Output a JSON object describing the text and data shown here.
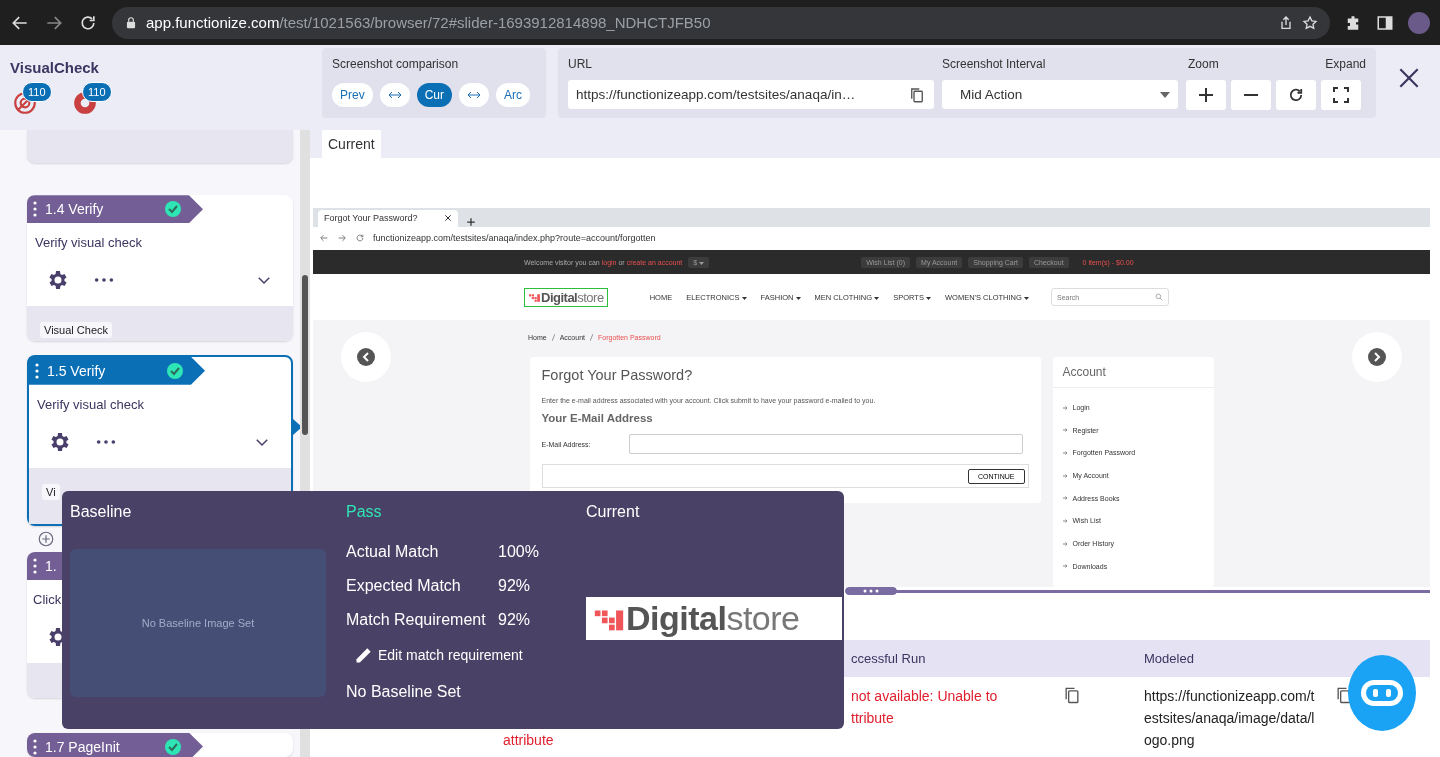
{
  "browser": {
    "url_host": "app.functionize.com",
    "url_path": "/test/1021563/browser/72#slider-1693912814898_NDHCTJFB50"
  },
  "app": {
    "title": "VisualCheck",
    "badges": [
      {
        "kind": "target",
        "count": "110"
      },
      {
        "kind": "donut",
        "count": "110"
      }
    ]
  },
  "comparison": {
    "label": "Screenshot comparison",
    "buttons": [
      {
        "kind": "text",
        "label": "Prev",
        "selected": false
      },
      {
        "kind": "swap",
        "selected": false
      },
      {
        "kind": "text",
        "label": "Cur",
        "selected": true
      },
      {
        "kind": "swap",
        "selected": false
      },
      {
        "kind": "text",
        "label": "Arc",
        "selected": false
      }
    ]
  },
  "url": {
    "label": "URL",
    "value": "https://functionizeapp.com/testsites/anaqa/in…"
  },
  "interval": {
    "label": "Screenshot Interval",
    "value": "Mid Action"
  },
  "zoom": {
    "label": "Zoom"
  },
  "expand": {
    "label": "Expand"
  },
  "steps": [
    {
      "title": "1.4 Verify",
      "description": "Verify visual check",
      "tag": "Visual Check",
      "passed": true,
      "selected": false
    },
    {
      "title": "1.5 Verify",
      "description": "Verify visual check",
      "tag": "Vi",
      "passed": true,
      "selected": true
    },
    {
      "title": "1.",
      "description": "Click",
      "selected": false
    },
    {
      "title": "1.7 PageInit",
      "passed": true,
      "selected": false
    }
  ],
  "main_tabs": [
    {
      "label": "Current",
      "selected": true
    }
  ],
  "inner": {
    "tab": "Forgot Your Password?",
    "address": "functionizeapp.com/testsites/anaqa/index.php?route=account/forgotten",
    "welcome": {
      "text": "Welcome visitor you can",
      "login": "login",
      "or": "or",
      "create": "create an account"
    },
    "currency": "$",
    "top_links": [
      "Wish List (0)",
      "My Account",
      "Shopping Cart",
      "Checkout"
    ],
    "cart": "0 item(s) - $0.00",
    "logo": "**Digital**store",
    "nav": [
      {
        "label": "HOME",
        "has_menu": false
      },
      {
        "label": "ELECTRONICS",
        "has_menu": true
      },
      {
        "label": "FASHION",
        "has_menu": true
      },
      {
        "label": "MEN CLOTHING",
        "has_menu": true
      },
      {
        "label": "SPORTS",
        "has_menu": true
      },
      {
        "label": "WOMEN'S CLOTHING",
        "has_menu": true
      }
    ],
    "search_placeholder": "Search",
    "breadcrumb": [
      {
        "label": "Home",
        "current": false
      },
      {
        "label": "Account",
        "current": false
      },
      {
        "label": "Forgotten Password",
        "current": true
      }
    ],
    "form": {
      "title": "Forgot Your Password?",
      "intro": "Enter the e-mail address associated with your account. Click submit to have your password e-mailed to you.",
      "section": "Your E-Mail Address",
      "field_label": "E-Mail Address:",
      "button": "CONTINUE"
    },
    "account": {
      "title": "Account",
      "links": [
        "Login",
        "Register",
        "Forgotten Password",
        "My Account",
        "Address Books",
        "Wish List",
        "Order History",
        "Downloads"
      ]
    }
  },
  "table": {
    "columns": [
      "ccessful Run",
      "Modeled"
    ],
    "rows": [
      {
        "column_2": "attribute",
        "column_3": "not available: Unable to\nttribute",
        "column_5": "https://functionizeapp.com/testsites/anaqa/image/data/logo.png"
      }
    ]
  },
  "popup": {
    "baseline": {
      "title": "Baseline",
      "placeholder": "No Baseline Image Set"
    },
    "result": {
      "status": "Pass",
      "kind": "pass",
      "metrics": [
        {
          "label": "Actual Match",
          "value": "100%"
        },
        {
          "label": "Expected Match",
          "value": "92%"
        },
        {
          "label": "Match Requirement",
          "value": "92%"
        }
      ],
      "edit_link": "Edit match requirement",
      "note": "No Baseline Set"
    },
    "current": {
      "title": "Current",
      "logo": "**Digital**store"
    }
  }
}
